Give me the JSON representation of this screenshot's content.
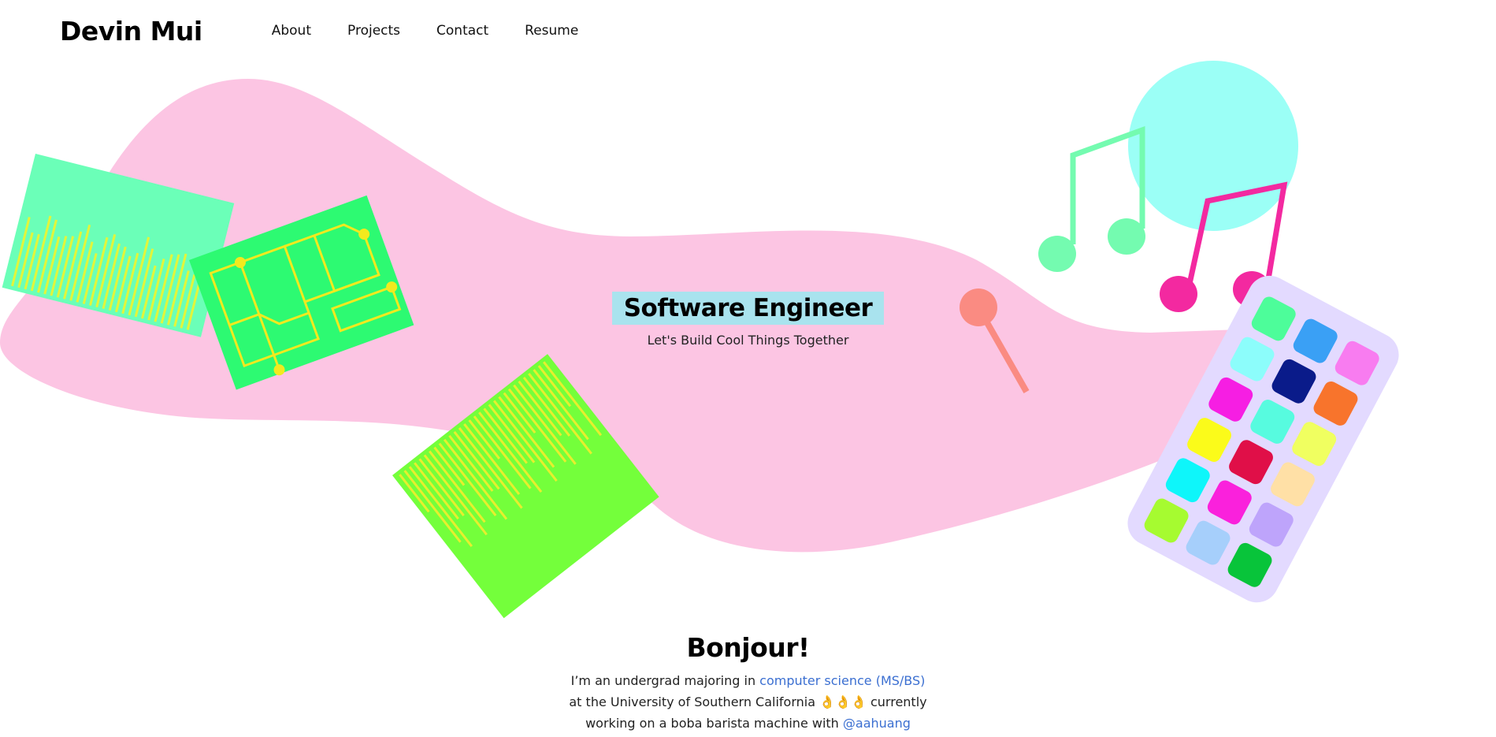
{
  "header": {
    "brand": "Devin Mui",
    "nav": [
      {
        "label": "About"
      },
      {
        "label": "Projects"
      },
      {
        "label": "Contact"
      },
      {
        "label": "Resume"
      }
    ]
  },
  "hero": {
    "title": "Software Engineer",
    "subtitle": "Let's Build Cool Things Together"
  },
  "intro": {
    "heading": "Bonjour!",
    "text_1": "I’m an undergrad majoring in ",
    "link_major": "computer science (MS/BS)",
    "text_2": " at the University of Southern California ",
    "emoji": "👌👌👌",
    "text_3": " currently working on a boba barista machine with ",
    "link_handle": "@aahuang"
  },
  "colors": {
    "blob": "#fcc5e3",
    "accent_link": "#3b6fd1",
    "title_highlight": "#a9e3ee"
  },
  "icons": [
    "circuit-board-icon",
    "music-notes-icon",
    "color-palette-phone-icon"
  ]
}
